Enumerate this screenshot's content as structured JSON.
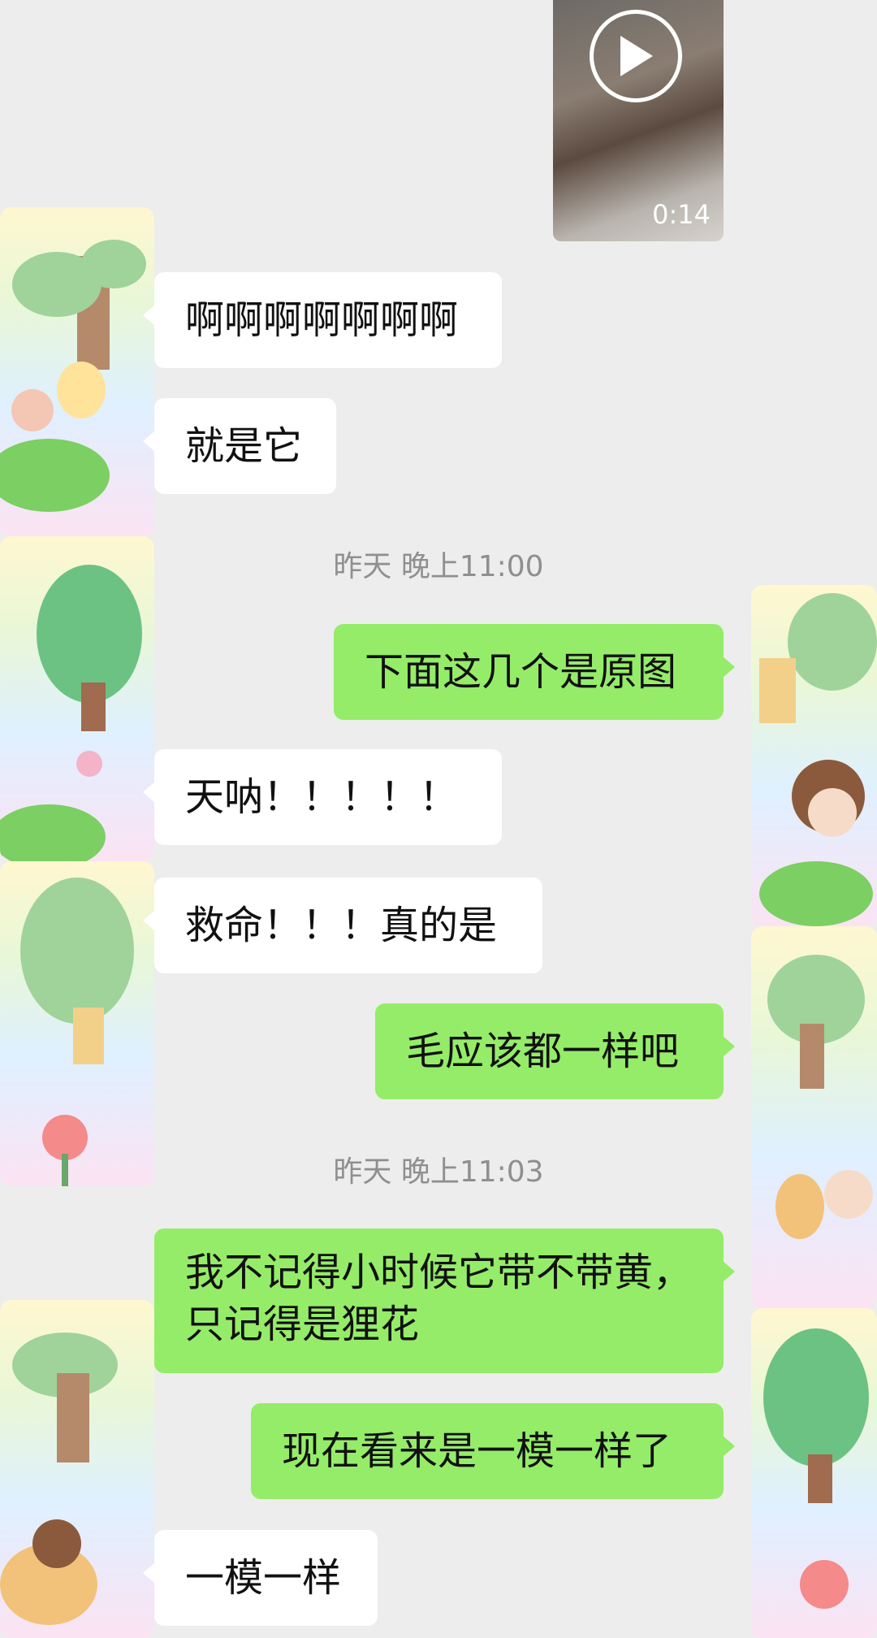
{
  "video": {
    "duration": "0:14",
    "play_icon": "play-icon"
  },
  "messages": [
    {
      "id": "m1",
      "side": "left",
      "text": "啊啊啊啊啊啊啊"
    },
    {
      "id": "m2",
      "side": "left",
      "text": "就是它"
    },
    {
      "id": "t1",
      "type": "timestamp",
      "text": "昨天 晚上11:00"
    },
    {
      "id": "m3",
      "side": "right",
      "text": "下面这几个是原图"
    },
    {
      "id": "m4",
      "side": "left",
      "text": "天呐！！！！！"
    },
    {
      "id": "m5",
      "side": "left",
      "text": "救命！！！真的是"
    },
    {
      "id": "m6",
      "side": "right",
      "text": "毛应该都一样吧"
    },
    {
      "id": "t2",
      "type": "timestamp",
      "text": "昨天 晚上11:03"
    },
    {
      "id": "m7",
      "side": "right",
      "lines": [
        "我不记得小时候它带不带黄，",
        "只记得是狸花"
      ]
    },
    {
      "id": "m8",
      "side": "right",
      "text": "现在看来是一模一样了"
    },
    {
      "id": "m9",
      "side": "left",
      "text": "一模一样"
    }
  ],
  "colors": {
    "bg": "#ededed",
    "sent_bubble": "#95ec69",
    "received_bubble": "#ffffff",
    "timestamp": "#8f8f8f"
  }
}
